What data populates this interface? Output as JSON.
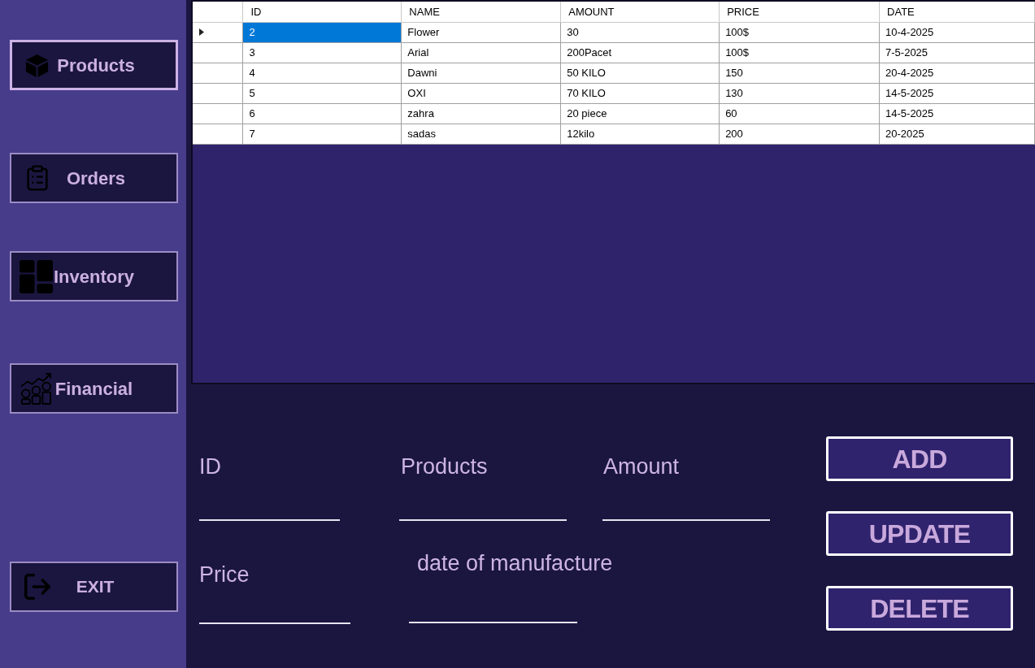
{
  "sidebar": {
    "items": [
      {
        "label": "Products",
        "selected": true
      },
      {
        "label": "Orders",
        "selected": false
      },
      {
        "label": "Inventory",
        "selected": false
      },
      {
        "label": "Financial",
        "selected": false
      }
    ],
    "exit_button": {
      "label": "EXIT"
    }
  },
  "table": {
    "columns": [
      "ID",
      "NAME",
      "AMOUNT",
      "PRICE",
      "DATE"
    ],
    "rows": [
      {
        "selected": true,
        "cells": [
          "2",
          "Flower",
          "30",
          "100$",
          "10-4-2025"
        ]
      },
      {
        "selected": false,
        "cells": [
          "3",
          "Arial",
          "200Pacet",
          "100$",
          "7-5-2025"
        ]
      },
      {
        "selected": false,
        "cells": [
          "4",
          "Dawni",
          "50 KILO",
          "150",
          "20-4-2025"
        ]
      },
      {
        "selected": false,
        "cells": [
          "5",
          "OXI",
          "70 KILO",
          "130",
          "14-5-2025"
        ]
      },
      {
        "selected": false,
        "cells": [
          "6",
          "zahra",
          "20 piece",
          "60",
          "14-5-2025"
        ]
      },
      {
        "selected": false,
        "cells": [
          "7",
          "sadas",
          "12kilo",
          "200",
          "20-2025"
        ]
      }
    ]
  },
  "form": {
    "fields": [
      {
        "label": "ID"
      },
      {
        "label": "Products"
      },
      {
        "label": "Amount"
      },
      {
        "label": "Price"
      },
      {
        "label": "date of manufacture"
      }
    ]
  },
  "actions": [
    "ADD",
    "UPDATE",
    "DELETE"
  ]
}
